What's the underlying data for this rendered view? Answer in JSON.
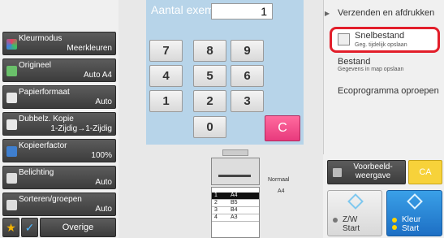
{
  "modes": [
    {
      "label": "Kleurmodus",
      "value": "Meerkleuren",
      "icon": "color-mode-icon",
      "color": "#e84060"
    },
    {
      "label": "Origineel",
      "value": "Auto  A4",
      "icon": "original-icon",
      "color": "#6ac06a"
    },
    {
      "label": "Papierformaat",
      "value": "Auto",
      "icon": "paper-size-icon",
      "color": "#e8e8e8"
    },
    {
      "label": "Dubbelz. Kopie",
      "value": "1-Zijdig→1-Zijdig",
      "icon": "duplex-icon",
      "color": "#e8e8e8"
    },
    {
      "label": "Kopieerfactor",
      "value": "100%",
      "icon": "copy-ratio-icon",
      "color": "#3f7fcf"
    },
    {
      "label": "Belichting",
      "value": "Auto",
      "icon": "exposure-icon",
      "color": "#dddddd"
    },
    {
      "label": "Sorteren/groepen",
      "value": "Auto",
      "icon": "sort-icon",
      "color": "#dddddd"
    }
  ],
  "bottom": {
    "overige_label": "Overige"
  },
  "keypad": {
    "copies_label": "Aantal exempl.",
    "copies_value": "1",
    "keys": [
      "7",
      "8",
      "9",
      "4",
      "5",
      "6",
      "1",
      "2",
      "3",
      "0"
    ],
    "clear_label": "C"
  },
  "right": {
    "title": "Verzenden en afdrukken",
    "snel_label": "Snelbestand",
    "snel_sub": "Geg. tijdelijk opslaan",
    "bestand_label": "Bestand",
    "bestand_sub": "Gegevens in map opslaan",
    "eco_label": "Ecoprogramma oproepen",
    "preview_line1": "Voorbeeld-",
    "preview_line2": "weergave",
    "ca_label": "CA",
    "start_bw_line1": "Z/W",
    "start_bw_line2": "Start",
    "start_color_line1": "Kleur",
    "start_color_line2": "Start"
  },
  "machine": {
    "normaal_label": "Normaal",
    "output_size": "A4",
    "trays": [
      {
        "num": "1",
        "size": "A4",
        "selected": true
      },
      {
        "num": "2",
        "size": "B5",
        "selected": false
      },
      {
        "num": "3",
        "size": "B4",
        "selected": false
      },
      {
        "num": "4",
        "size": "A3",
        "selected": false
      }
    ]
  }
}
